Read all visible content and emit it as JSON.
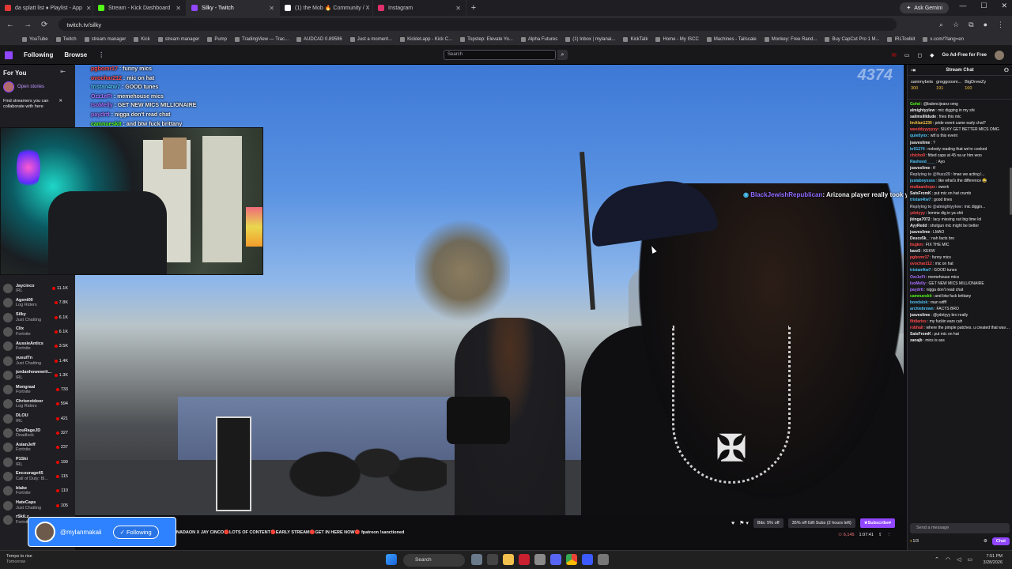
{
  "browser": {
    "tabs": [
      {
        "title": "da splatt list ♦ Playlist - App",
        "color": "#e53935",
        "active": false
      },
      {
        "title": "Stream - Kick Dashboard",
        "color": "#53fc18",
        "active": false
      },
      {
        "title": "Silky - Twitch",
        "color": "#9147ff",
        "active": true
      },
      {
        "title": "(1) the Mob 🔥 Community / X",
        "color": "#ffffff",
        "active": false
      },
      {
        "title": "Instagram",
        "color": "#e1306c",
        "active": false
      }
    ],
    "url": "twitch.tv/silky",
    "gemini": "Ask Gemini",
    "bookmarks": [
      "YouTube",
      "Twitch",
      "stream manager",
      "Kick",
      "stream manager",
      "Pump",
      "TradingView — Trac...",
      "AUDCAD 0.89596",
      "Just a moment...",
      "Kicklet.app - Kick C...",
      "Topstep: Elevate Yo...",
      "Alpha Futures",
      "(1) Inbox | mylanai...",
      "KickTalk",
      "Home - My ISCC",
      "Machines - Tailscale",
      "Monkey: Free Rand...",
      "Buy CapCut Pro 1 M...",
      "IRLToolkit",
      "x.com/?lang=en"
    ]
  },
  "twitch_nav": {
    "following": "Following",
    "browse": "Browse",
    "search_placeholder": "Search",
    "notif_count": "1",
    "ad_free": "Go Ad-Free for Free"
  },
  "sidebar": {
    "header": "For You",
    "stories": "Open stories",
    "find_text": "Find streamers you can collaborate with here",
    "channels": [
      {
        "name": "Jaycinco",
        "cat": "IRL",
        "viewers": "11.1K"
      },
      {
        "name": "Agent00",
        "cat": "Log Riders",
        "viewers": "7.8K"
      },
      {
        "name": "Silky",
        "cat": "Just Chatting",
        "viewers": "6.1K"
      },
      {
        "name": "Clix",
        "cat": "Fortnite",
        "viewers": "6.1K"
      },
      {
        "name": "AussieAntics",
        "cat": "Fortnite",
        "viewers": "3.5K"
      },
      {
        "name": "yusuf7n",
        "cat": "Just Chatting",
        "viewers": "1.4K"
      },
      {
        "name": "jordanhowewrit...",
        "cat": "IRL",
        "viewers": "1.3K"
      },
      {
        "name": "Mongraal",
        "cat": "Fortnite",
        "viewers": "733"
      },
      {
        "name": "Chrisnxtdoor",
        "cat": "Log Riders",
        "viewers": "594"
      },
      {
        "name": "DLOU",
        "cat": "IRL",
        "viewers": "421"
      },
      {
        "name": "CouRageJD",
        "cat": "Deadlock",
        "viewers": "327"
      },
      {
        "name": "AsianJeff",
        "cat": "Fortnite",
        "viewers": "237"
      },
      {
        "name": "P1Ski",
        "cat": "IRL",
        "viewers": "199"
      },
      {
        "name": "Encourage45",
        "cat": "Call of Duty: Bl...",
        "viewers": "115"
      },
      {
        "name": "blake",
        "cat": "Fortnite",
        "viewers": "110"
      },
      {
        "name": "HateCaps",
        "cat": "Just Chatting",
        "viewers": "105"
      },
      {
        "name": "rSkiLz",
        "cat": "Fortnite",
        "viewers": "88"
      }
    ]
  },
  "video": {
    "viewer_watermark": "4374",
    "overlay_chat": [
      {
        "user": "pgbomr17",
        "color": "#ff4a4a",
        "text": "funny mics"
      },
      {
        "user": "ovochar212",
        "color": "#ff4a4a",
        "text": "mic on hat"
      },
      {
        "user": "tristan4tw7",
        "color": "#4fc3f7",
        "text": "GOOD tunes"
      },
      {
        "user": "Ozz1eFt",
        "color": "#a970ff",
        "text": "memehouse mics"
      },
      {
        "user": "IsoMelly",
        "color": "#a970ff",
        "text": "GET NEW MICS MILLIONAIRE"
      },
      {
        "user": "paydrtt",
        "color": "#a970ff",
        "text": "nigga don't read chat"
      },
      {
        "user": "camnueskit",
        "color": "#53fc18",
        "text": "and btw fuck brittany"
      }
    ],
    "floating_user": "BlackJewishRepublican",
    "floating_text": ": Arizona player really took yo bitch wavy ?",
    "ticker": "NADAON X JAY CINCO🔴LOTS OF CONTENT🔴EARLY STREAM🔴GET IN HERE NOW🔴 fpatreon !sanctioned",
    "follow_user": "@mylanmakaii",
    "follow_label": "Following",
    "bits": "Bits: 5% off",
    "gift_subs": "35% off Gift Subs (2 hours left)",
    "subscribe": "Subscribe",
    "viewers": "6,145",
    "uptime": "1:07:41"
  },
  "chat": {
    "title": "Stream Chat",
    "leaders": [
      {
        "name": "sammybets",
        "val": "300"
      },
      {
        "name": "greggoosm...",
        "val": "191"
      },
      {
        "name": "BigDrewZy",
        "val": "100"
      }
    ],
    "messages": [
      {
        "u": "Gohd",
        "c": "#53fc18",
        "t": ": @balencijeanz omg"
      },
      {
        "u": "almightyylew",
        "c": "#efeff1",
        "t": ": mic digging in my shi"
      },
      {
        "u": "salimsillidude",
        "c": "#efeff1",
        "t": ": fries this mic"
      },
      {
        "u": "ImAlan1230",
        "c": "#f5c342",
        "t": ": pride event came early chat?"
      },
      {
        "u": "weeddyyyyyyy",
        "c": "#ff4a4a",
        "t": ": SILKY GET BETTER MICS OMG"
      },
      {
        "u": "quietlynx",
        "c": "#4fc3f7",
        "t": ": wtf is this event"
      },
      {
        "u": "jsaveslime",
        "c": "#efeff1",
        "t": ": ?"
      },
      {
        "u": "kr01274",
        "c": "#4fc3f7",
        "t": ": nobody reading that we're cooked"
      },
      {
        "u": "chicho9",
        "c": "#ff4a4a",
        "t": ": fitted caps at 45 na ur him woo"
      },
      {
        "u": "Rasheed____",
        "c": "#4fc3f7",
        "t": ": Ayo"
      },
      {
        "u": "jsaveslime",
        "c": "#efeff1",
        "t": ": tf"
      },
      {
        "u": "Replying to @Huzz29",
        "c": "#adadb8",
        "t": ": lmao we acting l..."
      },
      {
        "u": "justaboyssss",
        "c": "#4fc3f7",
        "t": ": like what's the difference 😂"
      },
      {
        "u": "multaardrops",
        "c": "#ff4a4a",
        "t": ": owerk"
      },
      {
        "u": "SatsFromK",
        "c": "#efeff1",
        "t": ": put mic on hat crumb"
      },
      {
        "u": "tristan4tw7",
        "c": "#4fc3f7",
        "t": ": good tines"
      },
      {
        "u": "Replying to @almightyylew",
        "c": "#adadb8",
        "t": ": mic diggin..."
      },
      {
        "u": "ydotyyy",
        "c": "#ff4a4a",
        "t": ": lemme dig in ya shit"
      },
      {
        "u": "jkinga7072",
        "c": "#efeff1",
        "t": ": lacy missing out big time lol"
      },
      {
        "u": "AyyRedd",
        "c": "#efeff1",
        "t": ": shotgun mic might be better"
      },
      {
        "u": "jsaveslime",
        "c": "#efeff1",
        "t": ": LMAO"
      },
      {
        "u": "Deuce5k_",
        "c": "#efeff1",
        "t": ": nah facts bro"
      },
      {
        "u": "itsgkm",
        "c": "#ff4a4a",
        "t": ": FIX THE MIC"
      },
      {
        "u": "barz5",
        "c": "#efeff1",
        "t": ": KEKW"
      },
      {
        "u": "pgbomr17",
        "c": "#ff4a4a",
        "t": ": funny mics"
      },
      {
        "u": "ovochar212",
        "c": "#ff4a4a",
        "t": ": mic on hat"
      },
      {
        "u": "tristan4tw7",
        "c": "#4fc3f7",
        "t": ": GOOD tunes"
      },
      {
        "u": "Ozz1eFt",
        "c": "#a970ff",
        "t": ": memehouse mics"
      },
      {
        "u": "IsoMelly",
        "c": "#a970ff",
        "t": ": GET NEW MICS MILLIONAIRE"
      },
      {
        "u": "paydrtt",
        "c": "#a970ff",
        "t": ": nigga don't read chat"
      },
      {
        "u": "camnueskit",
        "c": "#53fc18",
        "t": ": and btw fuck brittany"
      },
      {
        "u": "bondslok",
        "c": "#4fc3f7",
        "t": ": man wtfff"
      },
      {
        "u": "archiebrown",
        "c": "#4fc3f7",
        "t": ": FACTS BRO"
      },
      {
        "u": "jsaveslime",
        "c": "#efeff1",
        "t": ": @ydotyyy bro really"
      },
      {
        "u": "fitdiaries",
        "c": "#ff4a4a",
        "t": ": my fuckin ears cuh"
      },
      {
        "u": "robhall",
        "c": "#ff4a4a",
        "t": ": where the pimple patches. u created that wave woo"
      },
      {
        "u": "SatsFromK",
        "c": "#efeff1",
        "t": ": put mic on hat"
      },
      {
        "u": "zanajb",
        "c": "#efeff1",
        "t": ": mics is ass"
      }
    ],
    "input_placeholder": "Send a message",
    "points": "1/3",
    "chat_button": "Chat"
  },
  "taskbar": {
    "weather": "Temps to rise",
    "weather2": "Tomorrow",
    "search": "Search",
    "time": "7:51 PM",
    "date": "3/28/2026"
  }
}
